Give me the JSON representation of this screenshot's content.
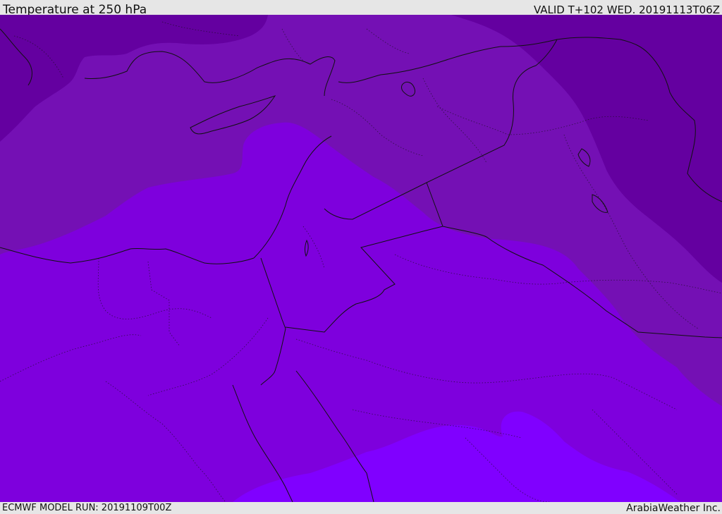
{
  "header": {
    "title": "Temperature at 250 hPa",
    "valid": "VALID T+102 WED. 20191113T06Z"
  },
  "footer": {
    "model_run": "ECMWF MODEL RUN: 20191109T00Z",
    "credit": "ArabiaWeather Inc."
  },
  "colors": {
    "band_darkest": "#6400a0",
    "band_dark": "#7410b4",
    "band_mid": "#7e00dd",
    "band_light": "#8000ff",
    "borders": "#111111"
  }
}
